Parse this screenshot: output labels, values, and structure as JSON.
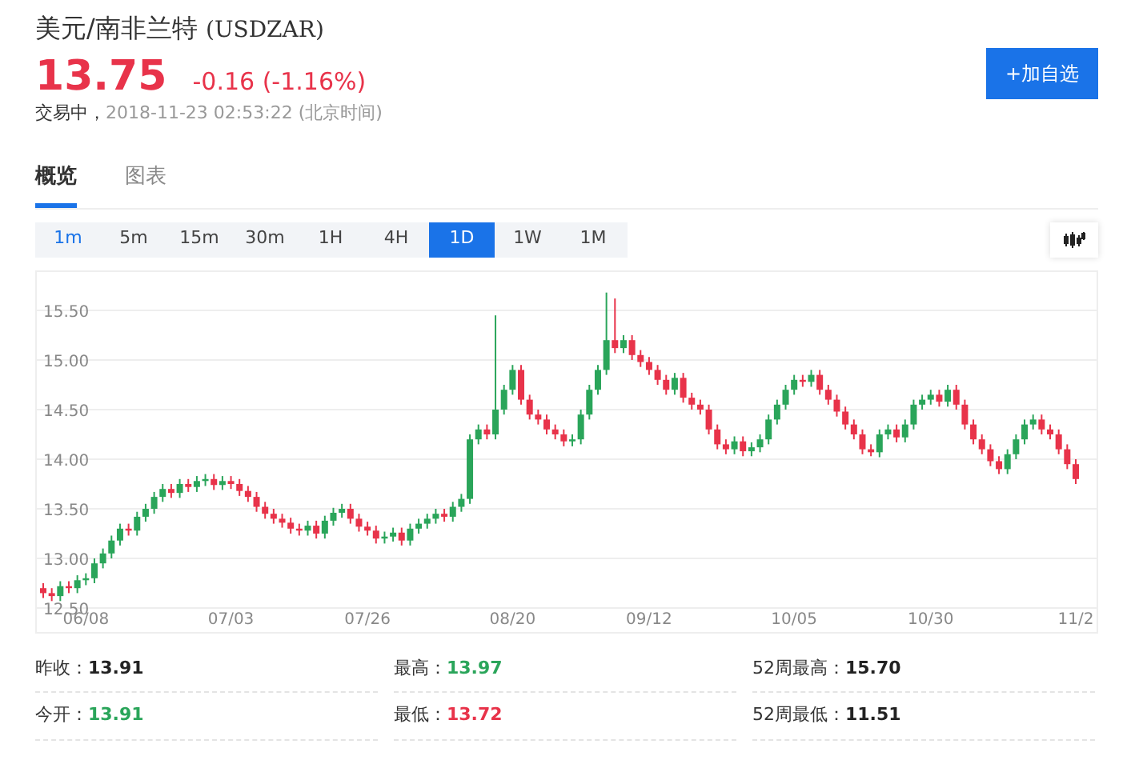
{
  "header": {
    "title": "美元/南非兰特",
    "symbol": "(USDZAR)",
    "price": "13.75",
    "change": "-0.16 (-1.16%)",
    "falling": true,
    "status": "交易中，",
    "time": "2018-11-23 02:53:22",
    "timezone": "(北京时间)",
    "watch_button": "+加自选"
  },
  "tabs": [
    {
      "label": "概览",
      "selected": true
    },
    {
      "label": "图表",
      "selected": false
    }
  ],
  "periods": [
    {
      "label": "1m",
      "selected": false
    },
    {
      "label": "5m",
      "selected": false
    },
    {
      "label": "15m",
      "selected": false
    },
    {
      "label": "30m",
      "selected": false
    },
    {
      "label": "1H",
      "selected": false
    },
    {
      "label": "4H",
      "selected": false
    },
    {
      "label": "1D",
      "selected": true
    },
    {
      "label": "1W",
      "selected": false
    },
    {
      "label": "1M",
      "selected": false
    }
  ],
  "chart": {
    "chart_data": {
      "type": "candlestick",
      "categories": [
        null,
        null,
        null,
        null,
        null,
        "06/08",
        null,
        null,
        null,
        null,
        null,
        null,
        null,
        null,
        null,
        null,
        null,
        null,
        null,
        null,
        null,
        null,
        "07/03",
        null,
        null,
        null,
        null,
        null,
        null,
        null,
        null,
        null,
        null,
        null,
        null,
        null,
        null,
        null,
        "07/26",
        null,
        null,
        null,
        null,
        null,
        null,
        null,
        null,
        null,
        null,
        null,
        null,
        null,
        null,
        null,
        null,
        "08/20",
        null,
        null,
        null,
        null,
        null,
        null,
        null,
        null,
        null,
        null,
        null,
        null,
        null,
        null,
        null,
        "09/12",
        null,
        null,
        null,
        null,
        null,
        null,
        null,
        null,
        null,
        null,
        null,
        null,
        null,
        null,
        null,
        null,
        "10/05",
        null,
        null,
        null,
        null,
        null,
        null,
        null,
        null,
        null,
        null,
        null,
        null,
        null,
        null,
        null,
        "10/30",
        null,
        null,
        null,
        null,
        null,
        null,
        null,
        null,
        null,
        null,
        null,
        null,
        null,
        null,
        null,
        null,
        "11/2"
      ],
      "ohlc": [
        [
          12.7,
          12.75,
          12.6,
          12.65
        ],
        [
          12.65,
          12.7,
          12.57,
          12.62
        ],
        [
          12.62,
          12.77,
          12.57,
          12.72
        ],
        [
          12.72,
          12.77,
          12.65,
          12.7
        ],
        [
          12.7,
          12.83,
          12.65,
          12.78
        ],
        [
          12.78,
          12.85,
          12.73,
          12.8
        ],
        [
          12.8,
          13.0,
          12.75,
          12.95
        ],
        [
          12.95,
          13.1,
          12.9,
          13.05
        ],
        [
          13.05,
          13.23,
          13.0,
          13.18
        ],
        [
          13.18,
          13.35,
          13.13,
          13.3
        ],
        [
          13.3,
          13.35,
          13.23,
          13.28
        ],
        [
          13.28,
          13.47,
          13.23,
          13.42
        ],
        [
          13.42,
          13.55,
          13.37,
          13.5
        ],
        [
          13.5,
          13.67,
          13.45,
          13.62
        ],
        [
          13.62,
          13.75,
          13.57,
          13.7
        ],
        [
          13.7,
          13.75,
          13.61,
          13.66
        ],
        [
          13.66,
          13.8,
          13.61,
          13.75
        ],
        [
          13.75,
          13.8,
          13.67,
          13.72
        ],
        [
          13.72,
          13.83,
          13.67,
          13.78
        ],
        [
          13.78,
          13.85,
          13.73,
          13.8
        ],
        [
          13.8,
          13.85,
          13.69,
          13.74
        ],
        [
          13.74,
          13.83,
          13.69,
          13.78
        ],
        [
          13.78,
          13.83,
          13.7,
          13.75
        ],
        [
          13.75,
          13.8,
          13.63,
          13.68
        ],
        [
          13.68,
          13.73,
          13.57,
          13.62
        ],
        [
          13.62,
          13.67,
          13.47,
          13.52
        ],
        [
          13.52,
          13.57,
          13.4,
          13.45
        ],
        [
          13.45,
          13.5,
          13.35,
          13.4
        ],
        [
          13.4,
          13.45,
          13.31,
          13.36
        ],
        [
          13.36,
          13.41,
          13.25,
          13.3
        ],
        [
          13.3,
          13.35,
          13.23,
          13.28
        ],
        [
          13.28,
          13.38,
          13.23,
          13.33
        ],
        [
          13.33,
          13.38,
          13.2,
          13.25
        ],
        [
          13.25,
          13.43,
          13.2,
          13.38
        ],
        [
          13.38,
          13.51,
          13.33,
          13.46
        ],
        [
          13.46,
          13.55,
          13.41,
          13.5
        ],
        [
          13.5,
          13.55,
          13.35,
          13.4
        ],
        [
          13.4,
          13.45,
          13.27,
          13.32
        ],
        [
          13.32,
          13.37,
          13.23,
          13.28
        ],
        [
          13.28,
          13.33,
          13.15,
          13.2
        ],
        [
          13.2,
          13.27,
          13.15,
          13.22
        ],
        [
          13.22,
          13.31,
          13.17,
          13.26
        ],
        [
          13.26,
          13.31,
          13.13,
          13.18
        ],
        [
          13.18,
          13.35,
          13.13,
          13.3
        ],
        [
          13.3,
          13.4,
          13.25,
          13.35
        ],
        [
          13.35,
          13.45,
          13.3,
          13.4
        ],
        [
          13.4,
          13.5,
          13.35,
          13.45
        ],
        [
          13.45,
          13.5,
          13.37,
          13.42
        ],
        [
          13.42,
          13.57,
          13.37,
          13.52
        ],
        [
          13.52,
          13.65,
          13.47,
          13.6
        ],
        [
          13.6,
          14.25,
          13.55,
          14.2
        ],
        [
          14.2,
          14.35,
          14.15,
          14.3
        ],
        [
          14.3,
          14.35,
          14.2,
          14.25
        ],
        [
          14.25,
          15.45,
          14.2,
          14.5
        ],
        [
          14.5,
          14.75,
          14.45,
          14.7
        ],
        [
          14.7,
          14.95,
          14.65,
          14.9
        ],
        [
          14.9,
          14.95,
          14.55,
          14.6
        ],
        [
          14.6,
          14.65,
          14.4,
          14.45
        ],
        [
          14.45,
          14.5,
          14.35,
          14.4
        ],
        [
          14.4,
          14.45,
          14.25,
          14.3
        ],
        [
          14.3,
          14.35,
          14.2,
          14.25
        ],
        [
          14.25,
          14.3,
          14.13,
          14.18
        ],
        [
          14.18,
          14.25,
          14.13,
          14.2
        ],
        [
          14.2,
          14.5,
          14.15,
          14.45
        ],
        [
          14.45,
          14.75,
          14.4,
          14.7
        ],
        [
          14.7,
          14.95,
          14.65,
          14.9
        ],
        [
          14.9,
          15.68,
          14.85,
          15.2
        ],
        [
          15.2,
          15.62,
          15.07,
          15.12
        ],
        [
          15.12,
          15.25,
          15.07,
          15.2
        ],
        [
          15.2,
          15.25,
          15.0,
          15.05
        ],
        [
          15.05,
          15.1,
          14.93,
          14.98
        ],
        [
          14.98,
          15.03,
          14.85,
          14.9
        ],
        [
          14.9,
          14.95,
          14.75,
          14.8
        ],
        [
          14.8,
          14.85,
          14.65,
          14.7
        ],
        [
          14.7,
          14.87,
          14.65,
          14.82
        ],
        [
          14.82,
          14.87,
          14.57,
          14.62
        ],
        [
          14.62,
          14.67,
          14.5,
          14.55
        ],
        [
          14.55,
          14.6,
          14.45,
          14.5
        ],
        [
          14.5,
          14.55,
          14.25,
          14.3
        ],
        [
          14.3,
          14.35,
          14.1,
          14.15
        ],
        [
          14.15,
          14.2,
          14.05,
          14.1
        ],
        [
          14.1,
          14.23,
          14.05,
          14.18
        ],
        [
          14.18,
          14.23,
          14.03,
          14.08
        ],
        [
          14.08,
          14.17,
          14.03,
          14.12
        ],
        [
          14.12,
          14.25,
          14.07,
          14.2
        ],
        [
          14.2,
          14.45,
          14.15,
          14.4
        ],
        [
          14.4,
          14.6,
          14.35,
          14.55
        ],
        [
          14.55,
          14.75,
          14.5,
          14.7
        ],
        [
          14.7,
          14.85,
          14.65,
          14.8
        ],
        [
          14.8,
          14.85,
          14.73,
          14.78
        ],
        [
          14.78,
          14.9,
          14.73,
          14.85
        ],
        [
          14.85,
          14.9,
          14.65,
          14.7
        ],
        [
          14.7,
          14.75,
          14.55,
          14.6
        ],
        [
          14.6,
          14.65,
          14.43,
          14.48
        ],
        [
          14.48,
          14.53,
          14.3,
          14.35
        ],
        [
          14.35,
          14.4,
          14.2,
          14.25
        ],
        [
          14.25,
          14.3,
          14.05,
          14.1
        ],
        [
          14.1,
          14.15,
          14.03,
          14.07
        ],
        [
          14.07,
          14.3,
          14.02,
          14.25
        ],
        [
          14.25,
          14.35,
          14.2,
          14.3
        ],
        [
          14.3,
          14.35,
          14.17,
          14.22
        ],
        [
          14.22,
          14.4,
          14.17,
          14.35
        ],
        [
          14.35,
          14.6,
          14.3,
          14.55
        ],
        [
          14.55,
          14.65,
          14.5,
          14.6
        ],
        [
          14.6,
          14.7,
          14.55,
          14.65
        ],
        [
          14.65,
          14.7,
          14.53,
          14.58
        ],
        [
          14.58,
          14.75,
          14.53,
          14.7
        ],
        [
          14.7,
          14.75,
          14.5,
          14.55
        ],
        [
          14.55,
          14.6,
          14.3,
          14.35
        ],
        [
          14.35,
          14.4,
          14.15,
          14.2
        ],
        [
          14.2,
          14.25,
          14.05,
          14.1
        ],
        [
          14.1,
          14.15,
          13.93,
          13.98
        ],
        [
          13.98,
          14.03,
          13.85,
          13.9
        ],
        [
          13.9,
          14.1,
          13.85,
          14.05
        ],
        [
          14.05,
          14.25,
          14.0,
          14.2
        ],
        [
          14.2,
          14.4,
          14.15,
          14.35
        ],
        [
          14.35,
          14.45,
          14.3,
          14.4
        ],
        [
          14.4,
          14.45,
          14.25,
          14.3
        ],
        [
          14.3,
          14.35,
          14.2,
          14.25
        ],
        [
          14.25,
          14.3,
          14.05,
          14.1
        ],
        [
          14.1,
          14.15,
          13.9,
          13.95
        ],
        [
          13.95,
          14.0,
          13.75,
          13.8
        ]
      ],
      "ylim": [
        12.5,
        15.5
      ],
      "grid": true,
      "yticks": [
        {
          "value": 15.5,
          "label": "15.50"
        },
        {
          "value": 15,
          "label": "15.00"
        },
        {
          "value": 14.5,
          "label": "14.50"
        },
        {
          "value": 14,
          "label": "14.00"
        },
        {
          "value": 13.5,
          "label": "13.50"
        },
        {
          "value": 13,
          "label": "13.00"
        },
        {
          "value": 12.5,
          "label": "12.50"
        }
      ]
    }
  },
  "stats": [
    {
      "label": "昨收：",
      "value": "13.91",
      "color": "#222222"
    },
    {
      "label": "最高：",
      "value": "13.97",
      "color": "#2aa55a"
    },
    {
      "label": "52周最高：",
      "value": "15.70",
      "color": "#222222"
    },
    {
      "label": "今开：",
      "value": "13.91",
      "color": "#2aa55a"
    },
    {
      "label": "最低：",
      "value": "13.72",
      "color": "#e8334a"
    },
    {
      "label": "52周最低：",
      "value": "11.51",
      "color": "#222222"
    }
  ]
}
